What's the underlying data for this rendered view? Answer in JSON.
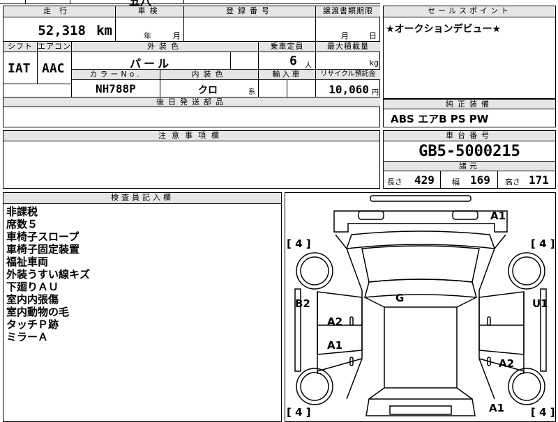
{
  "top": {
    "partial_title": "五八"
  },
  "main": {
    "mileage_label": "走行",
    "mileage_value": "52,318",
    "mileage_unit": "km",
    "inspection_label": "車検",
    "inspection_year": "年",
    "inspection_month": "月",
    "registration_label": "登録番号",
    "transfer_label": "譲渡書類期限",
    "transfer_month": "月",
    "transfer_day": "日",
    "shift_label": "シフト",
    "aircon_label": "エアコン",
    "exterior_color_label": "外装色",
    "capacity_label": "乗車定員",
    "max_load_label": "最大積載量",
    "shift_value": "IAT",
    "aircon_value": "AAC",
    "exterior_color_value": "パール",
    "capacity_value": "6",
    "capacity_unit": "人",
    "load_unit": "kg",
    "color_no_label": "カラーNo.",
    "interior_color_label": "内装色",
    "import_label": "輸入車",
    "recycle_label": "リサイクル預託金",
    "color_no_value": "NH788P",
    "interior_color_value": "クロ",
    "interior_color_suffix": "系",
    "recycle_value": "10,060",
    "recycle_unit": "円",
    "later_parts_label": "後日発送部品"
  },
  "sales": {
    "label": "セールスポイント",
    "text": "★オークションデビュー★"
  },
  "equipment": {
    "label": "純正装備",
    "value": "ABS エアB PS PW"
  },
  "caution": {
    "label": "注意事項欄"
  },
  "chassis": {
    "label": "車台番号",
    "value": "GB5-5000215"
  },
  "specs": {
    "label": "諸元",
    "length_label": "長さ",
    "length_value": "429",
    "width_label": "幅",
    "width_value": "169",
    "height_label": "高さ",
    "height_value": "171"
  },
  "inspector": {
    "label": "検査員記入欄",
    "notes": [
      "非課税",
      "席数５",
      "車椅子スロープ",
      "車椅子固定装置",
      "福祉車両",
      "外装うすい線キズ",
      "下廻りＡＵ",
      "室内内張傷",
      "室内動物の毛",
      "タッチＰ跡",
      "ミラーＡ"
    ]
  },
  "diagram": {
    "marks": {
      "a1_top": "A1",
      "tire_fl": "[ 4 ]",
      "tire_fr": "[ 4 ]",
      "tire_rl": "[ 4 ]",
      "tire_rr": "[ 4 ]",
      "b2": "B2",
      "u1": "U1",
      "g": "G",
      "a2_left": "A2",
      "a1_left": "A1",
      "a2_right": "A2",
      "a1_bottom": "A1"
    }
  }
}
